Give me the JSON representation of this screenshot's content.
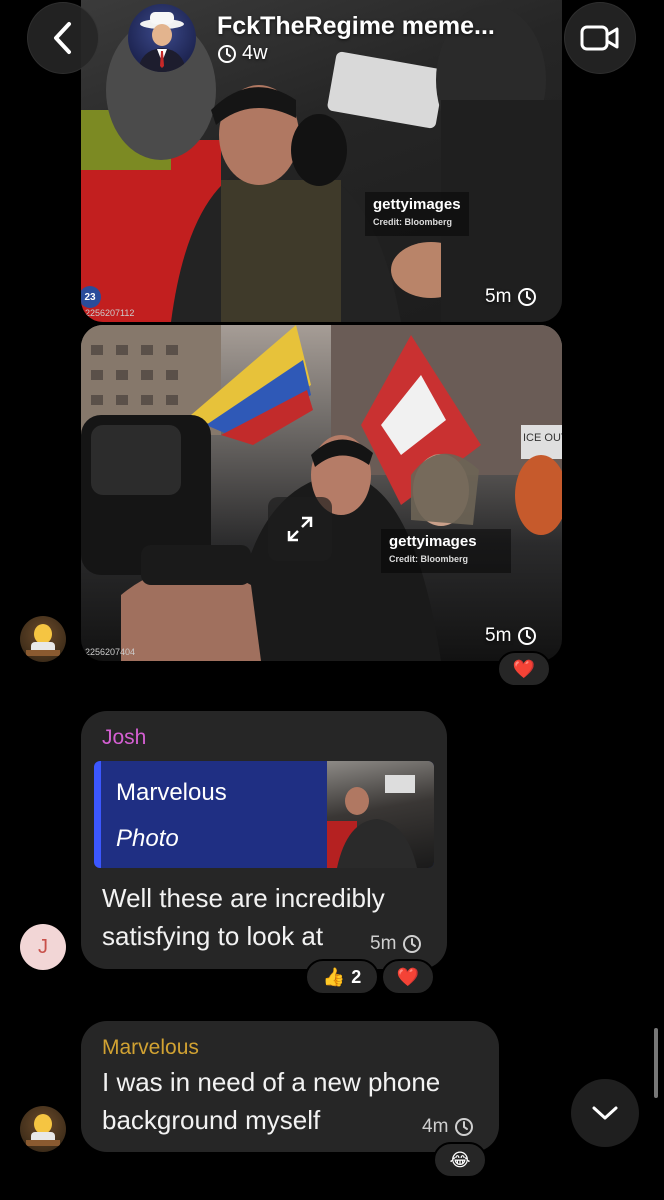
{
  "header": {
    "title": "FckTheRegime meme...",
    "timer_text": "4w",
    "icons": {
      "back": "chevron-left-icon",
      "video": "video-camera-icon",
      "timer": "timer-icon"
    }
  },
  "messages": [
    {
      "type": "photo",
      "watermark": "gettyimages",
      "credit": "Credit: Bloomberg",
      "image_id": "2256207112",
      "badge": "23",
      "time": "5m"
    },
    {
      "type": "photo",
      "watermark": "gettyimages",
      "credit": "Credit: Bloomberg",
      "image_id": "2256207404",
      "sign_text": "ICE OUT",
      "time": "5m",
      "reactions": [
        {
          "emoji": "❤️"
        }
      ]
    },
    {
      "type": "text",
      "sender": "Josh",
      "sender_color": "#d45fd2",
      "avatar_letter": "J",
      "reply": {
        "name": "Marvelous",
        "kind": "Photo"
      },
      "lines": [
        "Well these are incredibly",
        "satisfying to look at"
      ],
      "time": "5m",
      "reactions": [
        {
          "emoji": "👍",
          "count": "2"
        },
        {
          "emoji": "❤️"
        }
      ]
    },
    {
      "type": "text",
      "sender": "Marvelous",
      "sender_color": "#d1a232",
      "lines": [
        "I was in need of a new phone",
        "background myself"
      ],
      "time": "4m",
      "reactions": [
        {
          "emoji": "😂"
        }
      ]
    }
  ]
}
